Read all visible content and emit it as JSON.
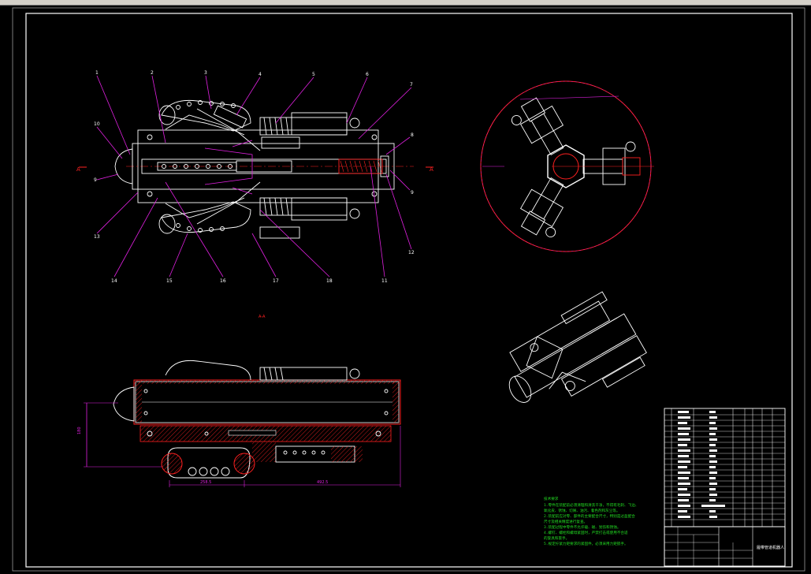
{
  "sheet": {
    "title_block_name": "履带管道机器人"
  },
  "views": {
    "section_label": "A-A",
    "section_marks": [
      "A",
      "A"
    ]
  },
  "dimensions": {
    "height": "180",
    "length_1": "258.5",
    "length_2": "492.5"
  },
  "callouts": {
    "top": [
      "1",
      "2",
      "3",
      "4",
      "5",
      "6",
      "7"
    ],
    "bottom": [
      "13",
      "14",
      "15",
      "16",
      "17",
      "18",
      "11",
      "12"
    ],
    "left": [
      "10",
      "9"
    ],
    "right": [
      "8",
      "9"
    ]
  },
  "technical_requirements": {
    "title": "技术要求",
    "lines": [
      "1.零件在装配前必须清理和清洗干净，不得有毛刺、飞边、",
      "  氧化皮、锈蚀、切屑、油污、着色剂和灰尘等。",
      "2.装配前应对零、部件的主要配合尺寸，特别是过盈配合",
      "  尺寸及相关精度进行复查。",
      "3.装配过程中零件不允许磕、碰、划伤和锈蚀。",
      "4.螺钉、螺栓和螺母紧固时，严禁打击或使用不合适",
      "  的旋具和扳手。",
      "5.规定拧紧力矩要求的紧固件，必须采用力矩扳手。"
    ]
  },
  "colors": {
    "drawing": "#ffffff",
    "leader": "#e020e0",
    "section": "#ff2020",
    "notes": "#22dd22",
    "background": "#000000"
  }
}
